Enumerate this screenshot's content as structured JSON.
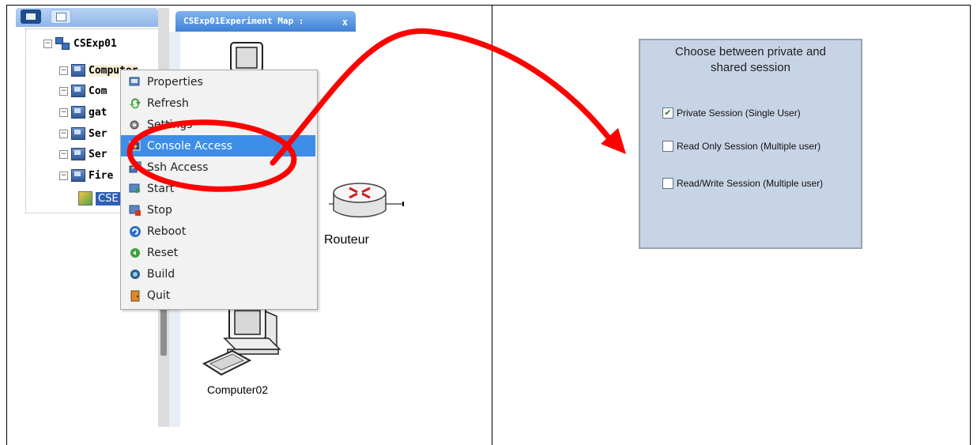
{
  "left_panel": {
    "tree": {
      "root": "CSExp01",
      "items": [
        "Computer",
        "Com",
        "gat",
        "Ser",
        "Ser",
        "Fire"
      ],
      "selected": "CSE"
    }
  },
  "map": {
    "tab_title": "CSExp01Experiment Map :",
    "close_glyph": "x",
    "devices": {
      "router_label": "Routeur",
      "computer_label": "Computer02"
    }
  },
  "context_menu": {
    "items": [
      {
        "label": "Properties",
        "icon": "properties-icon"
      },
      {
        "label": "Refresh",
        "icon": "refresh-icon"
      },
      {
        "label": "Settings",
        "icon": "settings-icon"
      },
      {
        "label": "Console Access",
        "icon": "console-icon"
      },
      {
        "label": "Ssh Access",
        "icon": "ssh-icon"
      },
      {
        "label": "Start",
        "icon": "start-icon"
      },
      {
        "label": "Stop",
        "icon": "stop-icon"
      },
      {
        "label": "Reboot",
        "icon": "reboot-icon"
      },
      {
        "label": "Reset",
        "icon": "reset-icon"
      },
      {
        "label": "Build",
        "icon": "build-icon"
      },
      {
        "label": "Quit",
        "icon": "quit-icon"
      }
    ],
    "active_item": "Console Access"
  },
  "session_dialog": {
    "title_line1": "Choose between private and",
    "title_line2": "shared session",
    "options": [
      {
        "label": "Private Session (Single User)",
        "checked": true
      },
      {
        "label": "Read Only Session (Multiple user)",
        "checked": false
      },
      {
        "label": "Read/Write Session (Multiple user)",
        "checked": false
      }
    ]
  },
  "colors": {
    "annotation": "#ff0000",
    "menu_highlight": "#3d8ee8",
    "dialog_bg": "#c7d4e6",
    "tree_selected": "#2e5fb5"
  }
}
